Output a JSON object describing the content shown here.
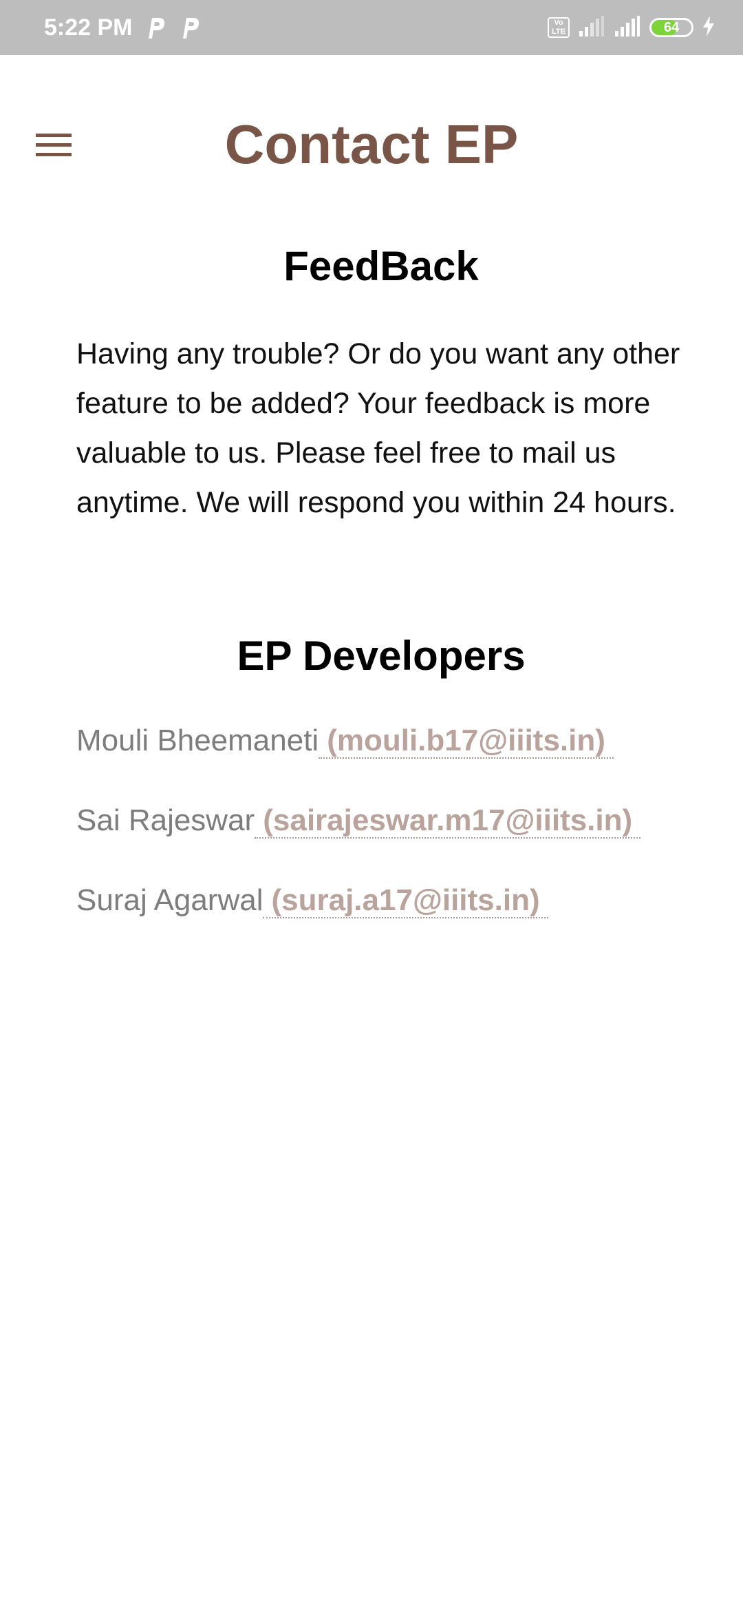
{
  "status_bar": {
    "time": "5:22 PM",
    "notification_icons": [
      "p-icon",
      "p-icon"
    ],
    "volte": "Vo LTE",
    "battery_level": "64",
    "battery_fraction": 0.64,
    "icons": [
      "volte-icon",
      "signal-icon",
      "signal-icon",
      "battery-icon",
      "charging-icon"
    ]
  },
  "app_bar": {
    "menu_icon": "hamburger-menu-icon",
    "title": "Contact EP",
    "title_color": "#795548"
  },
  "feedback": {
    "heading": "FeedBack",
    "body": "Having any trouble? Or do you want any other feature to be added? Your feedback is more valuable to us. Please feel free to mail us anytime. We will respond you within 24 hours."
  },
  "developers": {
    "heading": "EP Developers",
    "items": [
      {
        "name": "Mouli Bheemaneti",
        "email": "(mouli.b17@iiits.in)"
      },
      {
        "name": "Sai Rajeswar",
        "email": "(sairajeswar.m17@iiits.in)"
      },
      {
        "name": "Suraj Agarwal",
        "email": "(suraj.a17@iiits.in)"
      }
    ]
  },
  "colors": {
    "status_bar_bg": "#bdbdbd",
    "accent_brown": "#795548",
    "link": "#b9a39c",
    "name_gray": "#7d7d7d"
  }
}
